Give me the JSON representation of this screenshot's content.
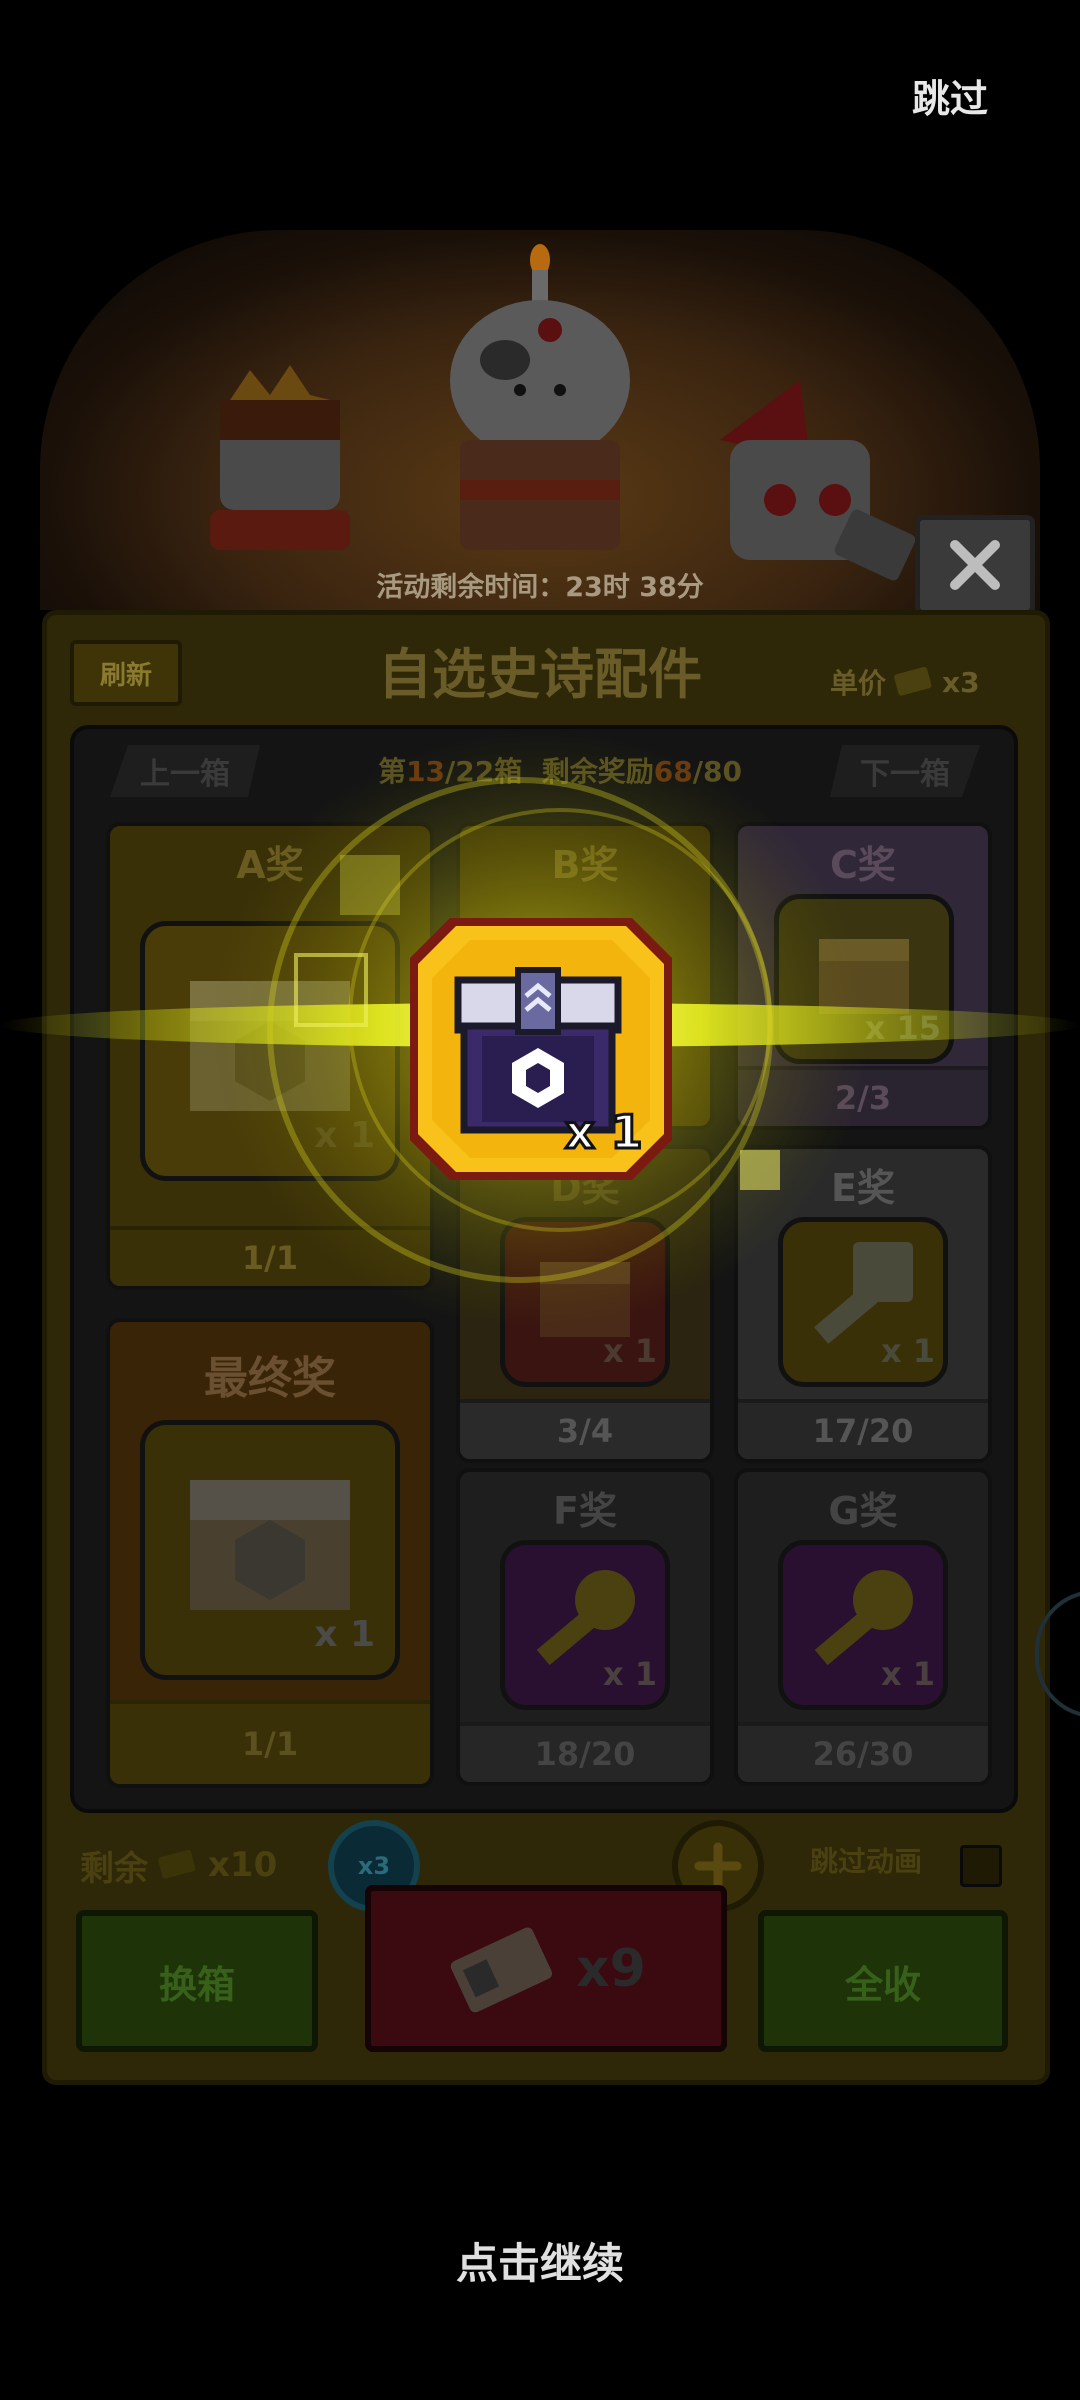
{
  "header": {
    "skip_label": "跳过"
  },
  "banner": {
    "timer_text": "活动剩余时间：23时 38分"
  },
  "panel": {
    "refresh_label": "刷新",
    "title": "自选史诗配件",
    "unit_price_label": "单价",
    "unit_price_qty": "x3"
  },
  "box_nav": {
    "prev_label": "上一箱",
    "next_label": "下一箱",
    "progress_prefix": "第",
    "box_current": "13",
    "box_total": "/22箱",
    "remain_prefix": "剩余奖励",
    "remain_current": "68",
    "remain_total": "/80"
  },
  "prizes": [
    {
      "name": "A奖",
      "qty": "x 1",
      "count": "1/1",
      "icon": "gear-chest-icon"
    },
    {
      "name": "B奖",
      "qty": "",
      "count": "",
      "icon": "gear-chest-icon"
    },
    {
      "name": "C奖",
      "qty": "x 15",
      "count": "2/3",
      "icon": "small-chest-icon"
    },
    {
      "name": "D奖",
      "qty": "x 1",
      "count": "3/4",
      "icon": "small-chest-icon"
    },
    {
      "name": "E奖",
      "qty": "x 1",
      "count": "17/20",
      "icon": "key-icon"
    },
    {
      "name": "最终奖",
      "qty": "x 1",
      "count": "1/1",
      "icon": "gear-chest-icon"
    },
    {
      "name": "F奖",
      "qty": "x 1",
      "count": "18/20",
      "icon": "key-icon"
    },
    {
      "name": "G奖",
      "qty": "x 1",
      "count": "26/30",
      "icon": "key-icon"
    }
  ],
  "bottom": {
    "remain_label": "剩余",
    "remain_qty": "x10",
    "multiplier": "x3",
    "skip_anim_label": "跳过动画",
    "swap_label": "换箱",
    "draw_qty": "x9",
    "collect_label": "全收"
  },
  "reward_popup": {
    "qty": "x 1",
    "icon": "epic-gear-chest-icon"
  },
  "continue_label": "点击继续",
  "colors": {
    "gold": "#f5c518",
    "glow": "#e6f01e",
    "panel": "#2e2808"
  }
}
